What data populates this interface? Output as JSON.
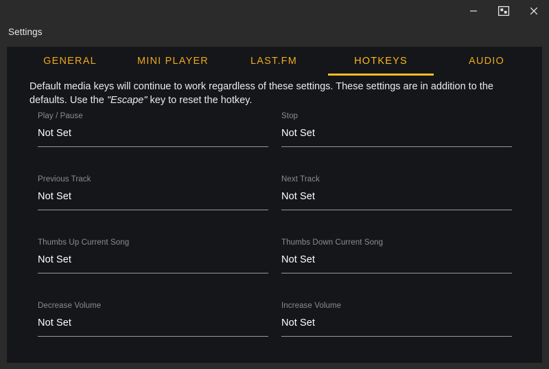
{
  "window": {
    "title": "Settings",
    "controls": [
      {
        "name": "minimize-button",
        "icon": "minimize-icon",
        "label": "Minimize"
      },
      {
        "name": "restore-button",
        "icon": "restore-window-icon",
        "label": "Restore"
      },
      {
        "name": "close-button",
        "icon": "close-icon",
        "label": "Close"
      }
    ],
    "colors": {
      "frame": "#2b2b2b",
      "panel": "#141619",
      "accent": "#ffc01e",
      "tab_text": "#f0a81e",
      "label_text": "#8d8d8d",
      "value_text": "#ffffff",
      "underline": "#9a9a9a"
    }
  },
  "tabs": [
    {
      "label": "GENERAL",
      "active": false
    },
    {
      "label": "MINI PLAYER",
      "active": false
    },
    {
      "label": "LAST.FM",
      "active": false
    },
    {
      "label": "HOTKEYS",
      "active": true
    },
    {
      "label": "AUDIO",
      "active": false
    }
  ],
  "description": {
    "part1": "Default media keys will continue to work regardless of these settings. These settings are in addition to the defaults. Use the ",
    "emphasis": "\"Escape\"",
    "part2": " key to reset the hotkey."
  },
  "hotkeys": [
    {
      "left": {
        "label": "Play / Pause",
        "value": "Not Set"
      },
      "right": {
        "label": "Stop",
        "value": "Not Set"
      }
    },
    {
      "left": {
        "label": "Previous Track",
        "value": "Not Set"
      },
      "right": {
        "label": "Next Track",
        "value": "Not Set"
      }
    },
    {
      "left": {
        "label": "Thumbs Up Current Song",
        "value": "Not Set"
      },
      "right": {
        "label": "Thumbs Down Current Song",
        "value": "Not Set"
      }
    },
    {
      "left": {
        "label": "Decrease Volume",
        "value": "Not Set"
      },
      "right": {
        "label": "Increase Volume",
        "value": "Not Set"
      }
    }
  ]
}
